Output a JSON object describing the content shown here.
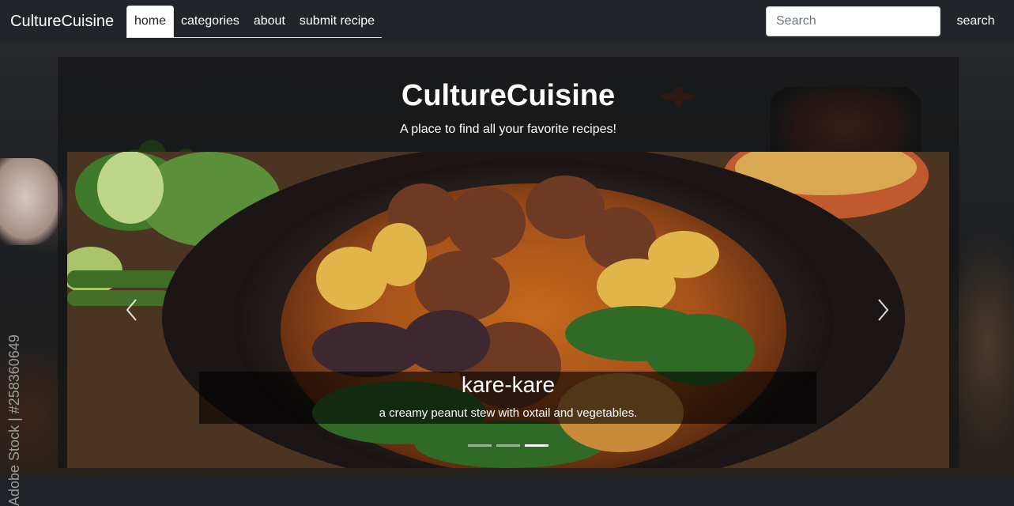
{
  "navbar": {
    "brand": "CultureCuisine",
    "tabs": [
      {
        "label": "home",
        "active": true
      },
      {
        "label": "categories",
        "active": false
      },
      {
        "label": "about",
        "active": false
      },
      {
        "label": "submit recipe",
        "active": false
      }
    ],
    "search_placeholder": "Search",
    "search_button": "search"
  },
  "background": {
    "watermark": "Adobe Stock | #258360649"
  },
  "hero": {
    "title": "CultureCuisine",
    "subtitle": "A place to find all your favorite recipes!"
  },
  "carousel": {
    "slides": 3,
    "active_slide": 3,
    "caption_title": "kare-kare",
    "caption_text": "a creamy peanut stew with oxtail and vegetables.",
    "prev_icon": "chevron-left-icon",
    "next_icon": "chevron-right-icon"
  },
  "colors": {
    "navbar": "#212529",
    "accent_text": "#ffffff"
  }
}
